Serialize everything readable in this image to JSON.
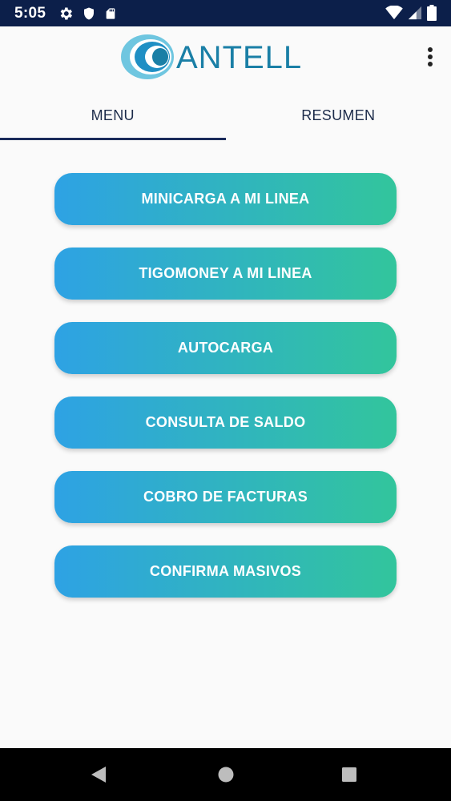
{
  "status_bar": {
    "time": "5:05",
    "icons": [
      "settings-icon",
      "shield-icon",
      "sd-card-icon",
      "wifi-icon",
      "signal-icon",
      "battery-icon"
    ]
  },
  "app_bar": {
    "logo_text": "ANTELL",
    "menu_icon": "more-vert-icon",
    "brand_color": "#1a7fa6"
  },
  "tabs": [
    {
      "label": "MENU",
      "active": true
    },
    {
      "label": "RESUMEN",
      "active": false
    }
  ],
  "menu": {
    "items": [
      {
        "label": "MINICARGA A MI LINEA"
      },
      {
        "label": "TIGOMONEY A MI LINEA"
      },
      {
        "label": "AUTOCARGA"
      },
      {
        "label": "CONSULTA DE SALDO"
      },
      {
        "label": "COBRO DE FACTURAS"
      },
      {
        "label": "CONFIRMA MASIVOS"
      }
    ],
    "gradient_start": "#2ea2e4",
    "gradient_end": "#32c59c"
  },
  "nav_bar": {
    "icons": [
      "back-icon",
      "home-icon",
      "recents-icon"
    ]
  }
}
